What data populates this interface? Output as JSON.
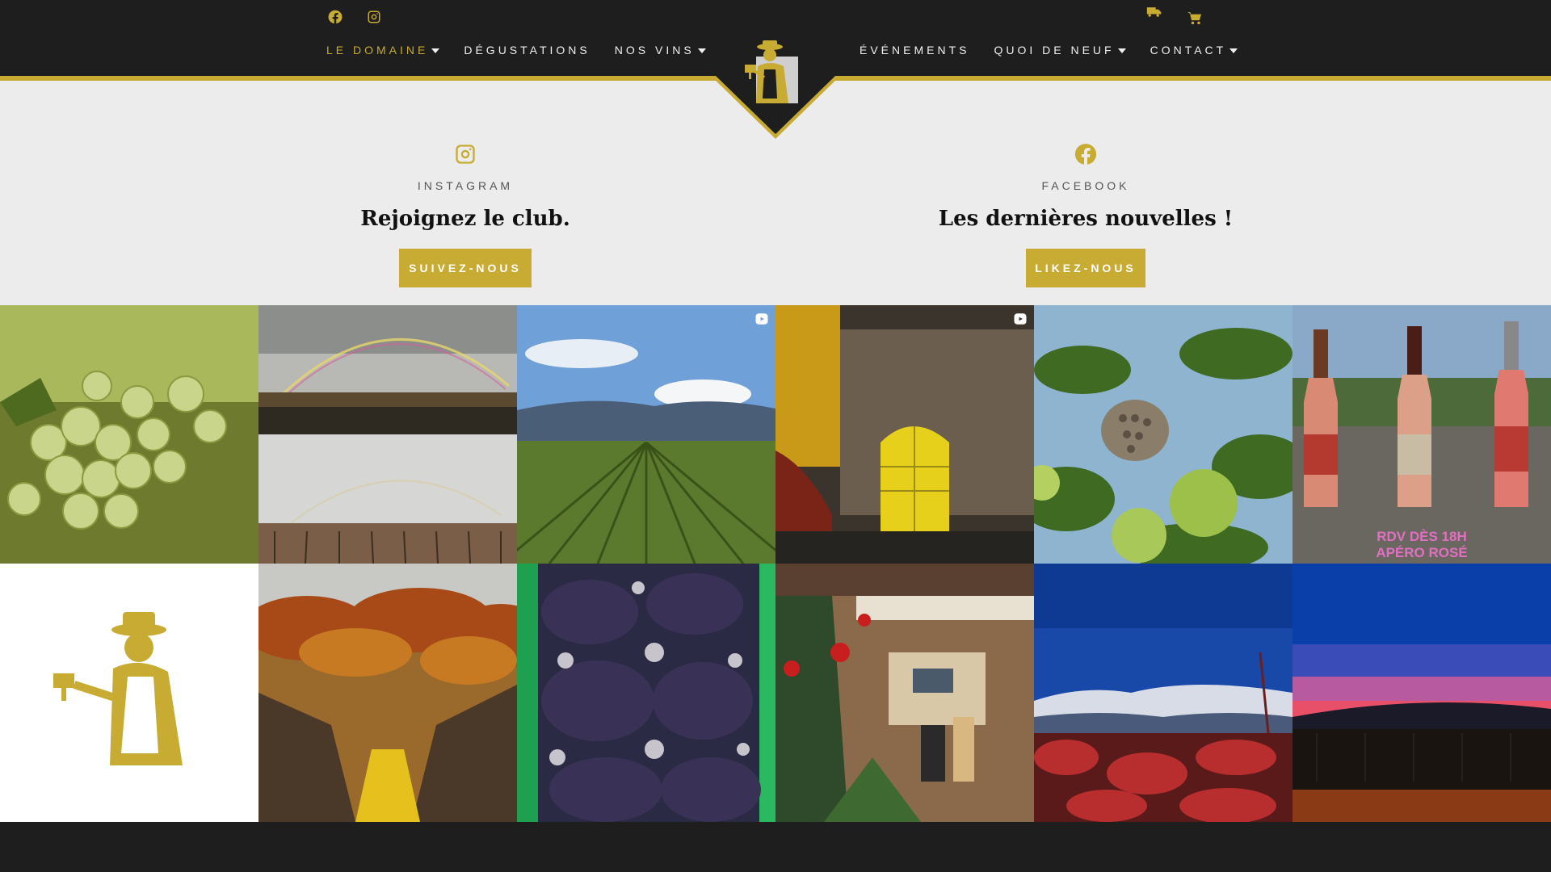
{
  "header": {
    "social": [
      {
        "icon": "facebook-icon"
      },
      {
        "icon": "instagram-icon"
      }
    ],
    "utility": [
      {
        "icon": "delivery-truck-icon"
      },
      {
        "icon": "shopping-cart-icon"
      }
    ],
    "nav_left": [
      {
        "label": "LE DOMAINE",
        "dropdown": true,
        "active": true
      },
      {
        "label": "DÉGUSTATIONS",
        "dropdown": false
      },
      {
        "label": "NOS VINS",
        "dropdown": true
      }
    ],
    "nav_right": [
      {
        "label": "ÉVÉNEMENTS",
        "dropdown": false
      },
      {
        "label": "QUOI DE NEUF",
        "dropdown": true
      },
      {
        "label": "CONTACT",
        "dropdown": true
      }
    ]
  },
  "cta_instagram": {
    "icon": "instagram-icon",
    "label": "INSTAGRAM",
    "title": "Rejoignez le club.",
    "button": "SUIVEZ-NOUS"
  },
  "cta_facebook": {
    "icon": "facebook-icon",
    "label": "FACEBOOK",
    "title": "Les dernières nouvelles !",
    "button": "LIKEZ-NOUS"
  },
  "feed": {
    "tiles": [
      {
        "name": "white-grapes"
      },
      {
        "name": "rainbow-over-vineyard"
      },
      {
        "name": "vineyard-rows-mountains",
        "reel": true
      },
      {
        "name": "cellar-door-night",
        "reel": true
      },
      {
        "name": "wasp-nest-apples"
      },
      {
        "name": "rose-wine-bottles",
        "caption": "RDV DÈS 18H APÉRO ROSÉ"
      },
      {
        "name": "logo-winemaker"
      },
      {
        "name": "autumn-vineyard"
      },
      {
        "name": "grape-pomace"
      },
      {
        "name": "christmas-tasting-room"
      },
      {
        "name": "snowy-mountains-red-vines"
      },
      {
        "name": "sunset-over-vineyard"
      }
    ]
  },
  "colors": {
    "accent": "#c8ab32",
    "header_bg": "#1e1e1e",
    "page_bg": "#ececec"
  }
}
